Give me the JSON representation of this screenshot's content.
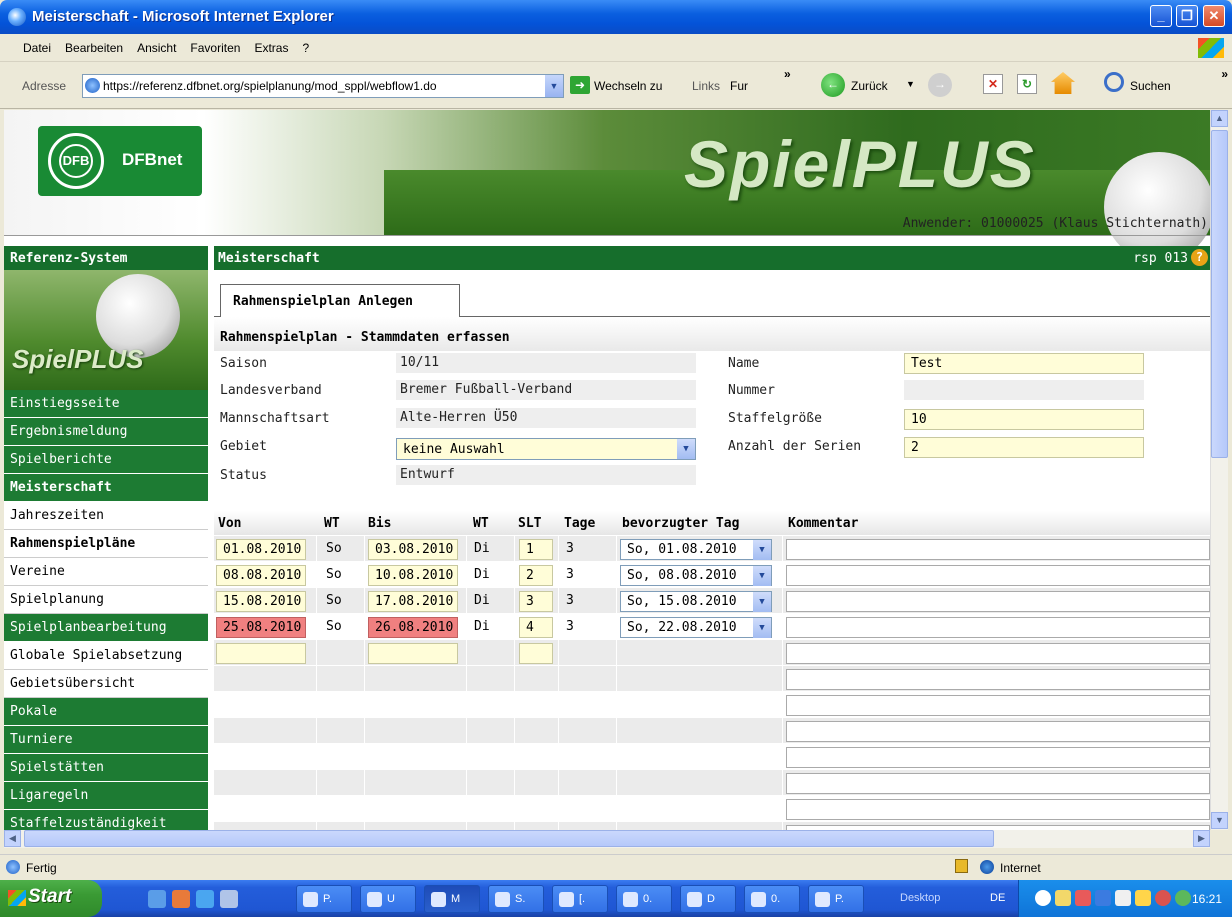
{
  "window": {
    "title": "Meisterschaft - Microsoft Internet Explorer"
  },
  "menu": {
    "items": [
      "Datei",
      "Bearbeiten",
      "Ansicht",
      "Favoriten",
      "Extras",
      "?"
    ]
  },
  "address": {
    "label": "Adresse",
    "url": "https://referenz.dfbnet.org/spielplanung/mod_sppl/webflow1.do",
    "go_label": "Wechseln zu",
    "links_label": "Links",
    "links_item": "Fur",
    "back_label": "Zurück",
    "search_label": "Suchen"
  },
  "banner": {
    "logo_text": "DFBnet",
    "logo_emblem": "DFB",
    "app_title": "SpielPLUS",
    "user": "Anwender: 01000025 (Klaus Stichternath)"
  },
  "nav": {
    "header": "Referenz-System",
    "logo": "SpielPLUS",
    "items": [
      {
        "label": "Einstiegsseite"
      },
      {
        "label": "Ergebnismeldung"
      },
      {
        "label": "Spielberichte"
      },
      {
        "label": "Meisterschaft"
      },
      {
        "label": "Jahreszeiten"
      },
      {
        "label": "Rahmenspielpläne"
      },
      {
        "label": "Vereine"
      },
      {
        "label": "Spielplanung"
      },
      {
        "label": "Spielplanbearbeitung"
      },
      {
        "label": "Globale Spielabsetzung"
      },
      {
        "label": "Gebietsübersicht"
      },
      {
        "label": "Pokale"
      },
      {
        "label": "Turniere"
      },
      {
        "label": "Spielstätten"
      },
      {
        "label": "Ligaregeln"
      },
      {
        "label": "Staffelzuständigkeit"
      }
    ]
  },
  "main": {
    "header": "Meisterschaft",
    "code": "rsp 013",
    "help": "?",
    "tab": "Rahmenspielplan Anlegen",
    "section_title": "Rahmenspielplan - Stammdaten erfassen",
    "fields": {
      "saison_label": "Saison",
      "saison": "10/11",
      "landesverband_label": "Landesverband",
      "landesverband": "Bremer Fußball-Verband",
      "mannschaftsart_label": "Mannschaftsart",
      "mannschaftsart": "Alte-Herren Ü50",
      "gebiet_label": "Gebiet",
      "gebiet": "keine Auswahl",
      "status_label": "Status",
      "status": "Entwurf",
      "name_label": "Name",
      "name": "Test",
      "nummer_label": "Nummer",
      "nummer": "",
      "staffel_label": "Staffelgröße",
      "staffel": "10",
      "serien_label": "Anzahl der Serien",
      "serien": "2"
    },
    "table": {
      "headers": [
        "Von",
        "WT",
        "Bis",
        "WT",
        "SLT",
        "Tage",
        "bevorzugter Tag",
        "Kommentar"
      ],
      "rows": [
        {
          "von": "01.08.2010",
          "wt1": "So",
          "bis": "03.08.2010",
          "wt2": "Di",
          "slt": "1",
          "tage": "3",
          "tag": "So, 01.08.2010",
          "kommentar": ""
        },
        {
          "von": "08.08.2010",
          "wt1": "So",
          "bis": "10.08.2010",
          "wt2": "Di",
          "slt": "2",
          "tage": "3",
          "tag": "So, 08.08.2010",
          "kommentar": ""
        },
        {
          "von": "15.08.2010",
          "wt1": "So",
          "bis": "17.08.2010",
          "wt2": "Di",
          "slt": "3",
          "tage": "3",
          "tag": "So, 15.08.2010",
          "kommentar": ""
        },
        {
          "von": "25.08.2010",
          "wt1": "So",
          "bis": "26.08.2010",
          "wt2": "Di",
          "slt": "4",
          "tage": "3",
          "tag": "So, 22.08.2010",
          "kommentar": ""
        }
      ]
    }
  },
  "status": {
    "text": "Fertig",
    "zone": "Internet"
  },
  "taskbar": {
    "start": "Start",
    "tasks": [
      "P.",
      "U",
      "M",
      "S.",
      "[.",
      "0.",
      "D",
      "0.",
      "P."
    ],
    "desktop": "Desktop",
    "lang": "DE",
    "clock": "16:21"
  },
  "colors": {
    "nav_green": "#1D7B33",
    "header_green": "#166E2C",
    "input_yellow": "#FFFDD8",
    "error_red": "#F08080"
  }
}
